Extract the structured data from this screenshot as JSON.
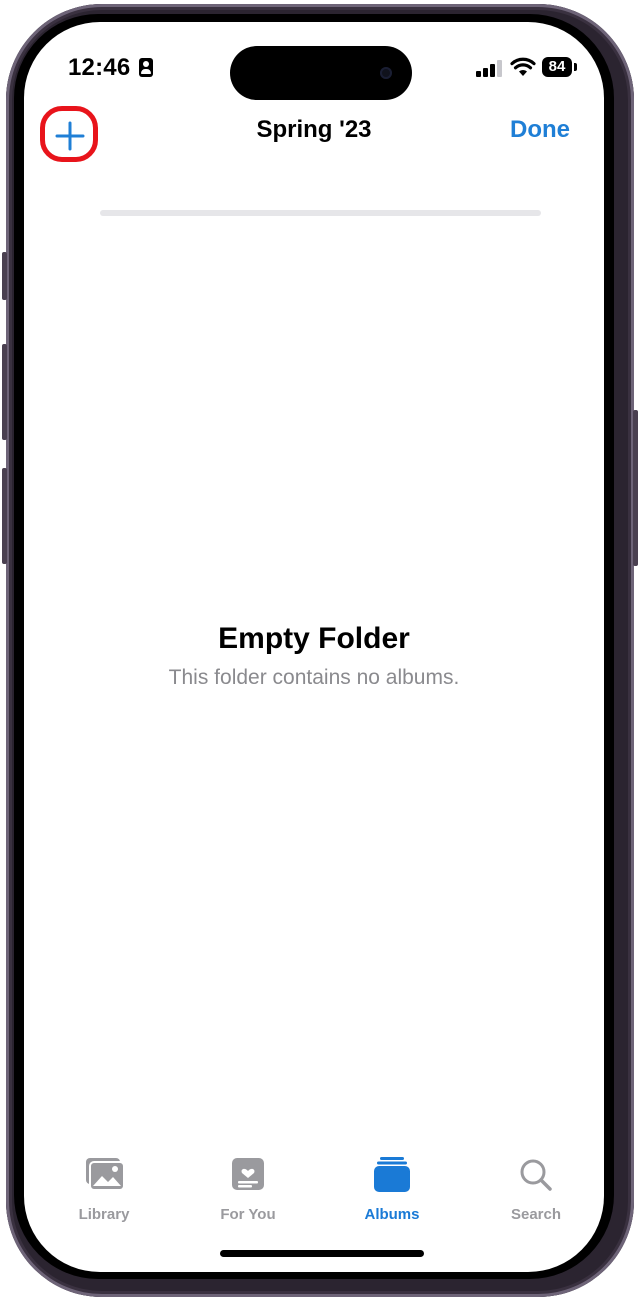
{
  "status_bar": {
    "time": "12:46",
    "battery": "84"
  },
  "nav": {
    "title": "Spring '23",
    "done_label": "Done",
    "add_icon": "plus-icon"
  },
  "progress": {
    "level": 0
  },
  "empty_state": {
    "title": "Empty Folder",
    "subtitle": "This folder contains no albums."
  },
  "tab_bar": {
    "items": [
      {
        "label": "Library",
        "icon": "photo-library-icon",
        "active": false
      },
      {
        "label": "For You",
        "icon": "for-you-icon",
        "active": false
      },
      {
        "label": "Albums",
        "icon": "albums-icon",
        "active": true
      },
      {
        "label": "Search",
        "icon": "search-icon",
        "active": false
      }
    ]
  },
  "colors": {
    "accent": "#1f7fd6",
    "highlight": "#e8141b",
    "inactive": "#9a9a9e",
    "frame": "#2b2430"
  }
}
